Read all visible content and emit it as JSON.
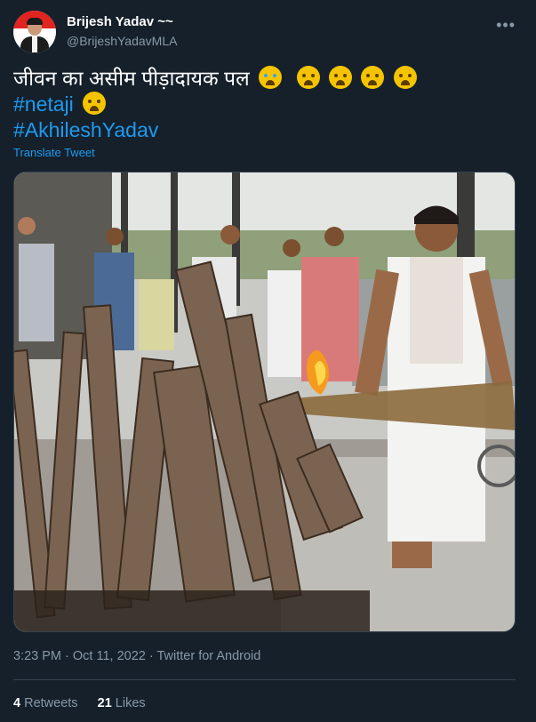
{
  "user": {
    "name": "Brijesh Yadav ~~",
    "handle": "@BrijeshYadavMLA"
  },
  "tweet": {
    "line1": "जीवन का असीम पीड़ादायक पल",
    "hashtag1": "#netaji",
    "hashtag2": "#AkhileshYadav",
    "emojis_line1": [
      "crying-face",
      "loudly-crying-face",
      "loudly-crying-face",
      "loudly-crying-face",
      "loudly-crying-face"
    ],
    "emojis_line2": [
      "loudly-crying-face"
    ]
  },
  "translate_label": "Translate Tweet",
  "meta": {
    "time": "3:23 PM",
    "date": "Oct 11, 2022",
    "client": "Twitter for Android"
  },
  "stats": {
    "retweets_count": "4",
    "retweets_label": "Retweets",
    "likes_count": "21",
    "likes_label": "Likes"
  },
  "colors": {
    "background": "#15202b",
    "link": "#1d9bf0",
    "secondary_text": "#8899a6"
  }
}
